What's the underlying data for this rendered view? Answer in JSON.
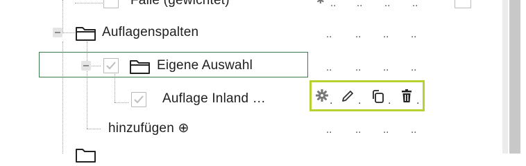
{
  "tree": {
    "row_top_partial_label": "Fälle (gewichtet)",
    "row_auflagenspalten_label": "Auflagenspalten",
    "row_eigene_auswahl_label": "Eigene Auswahl",
    "row_auflage_inland_label": "Auflage Inland …",
    "row_hinzufuegen_label": "hinzufügen ⊕"
  },
  "cells": {
    "placeholder": "..",
    "action_sep": "."
  },
  "icons": {
    "settings": "gear-icon",
    "edit": "pencil-icon",
    "copy": "copy-icon",
    "delete": "trash-icon",
    "folder": "folder-icon",
    "checkbox": "checkbox-icon",
    "add": "plus-circle-icon"
  },
  "colors": {
    "selection_border": "#3a7a4a",
    "action_highlight": "#b7d12e"
  }
}
